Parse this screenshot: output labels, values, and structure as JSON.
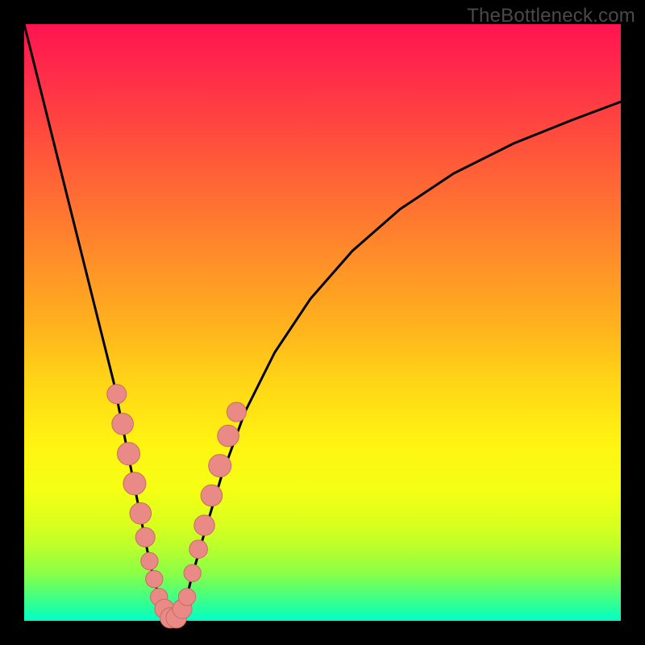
{
  "watermark": "TheBottleneck.com",
  "chart_data": {
    "type": "line",
    "title": "",
    "xlabel": "",
    "ylabel": "",
    "xlim": [
      0,
      100
    ],
    "ylim": [
      0,
      100
    ],
    "series": [
      {
        "name": "bottleneck-curve",
        "x": [
          0,
          3,
          6,
          9,
          12,
          15,
          17,
          19,
          20,
          21,
          22,
          23,
          24,
          25,
          26,
          27,
          28,
          30,
          33,
          37,
          42,
          48,
          55,
          63,
          72,
          82,
          92,
          100
        ],
        "y": [
          100,
          88,
          76,
          64,
          52,
          40,
          30,
          20,
          15,
          10,
          6,
          3,
          1,
          0,
          1,
          3,
          7,
          14,
          24,
          35,
          45,
          54,
          62,
          69,
          75,
          80,
          84,
          87
        ]
      }
    ],
    "markers": {
      "name": "highlight-beads",
      "points": [
        {
          "x": 15.5,
          "y": 38,
          "r": 1.2
        },
        {
          "x": 16.5,
          "y": 33,
          "r": 1.4
        },
        {
          "x": 17.5,
          "y": 28,
          "r": 1.5
        },
        {
          "x": 18.5,
          "y": 23,
          "r": 1.5
        },
        {
          "x": 19.5,
          "y": 18,
          "r": 1.4
        },
        {
          "x": 20.3,
          "y": 14,
          "r": 1.2
        },
        {
          "x": 21.0,
          "y": 10,
          "r": 1.0
        },
        {
          "x": 21.8,
          "y": 7,
          "r": 1.0
        },
        {
          "x": 22.6,
          "y": 4,
          "r": 1.0
        },
        {
          "x": 23.5,
          "y": 2,
          "r": 1.2
        },
        {
          "x": 24.5,
          "y": 0.5,
          "r": 1.3
        },
        {
          "x": 25.5,
          "y": 0.5,
          "r": 1.3
        },
        {
          "x": 26.5,
          "y": 2,
          "r": 1.2
        },
        {
          "x": 27.3,
          "y": 4,
          "r": 1.0
        },
        {
          "x": 28.2,
          "y": 8,
          "r": 1.0
        },
        {
          "x": 29.2,
          "y": 12,
          "r": 1.1
        },
        {
          "x": 30.2,
          "y": 16,
          "r": 1.3
        },
        {
          "x": 31.4,
          "y": 21,
          "r": 1.4
        },
        {
          "x": 32.8,
          "y": 26,
          "r": 1.5
        },
        {
          "x": 34.2,
          "y": 31,
          "r": 1.4
        },
        {
          "x": 35.6,
          "y": 35,
          "r": 1.2
        }
      ]
    },
    "background_gradient": {
      "top": "#ff1450",
      "mid": "#fff312",
      "bottom": "#00ffc8"
    }
  }
}
